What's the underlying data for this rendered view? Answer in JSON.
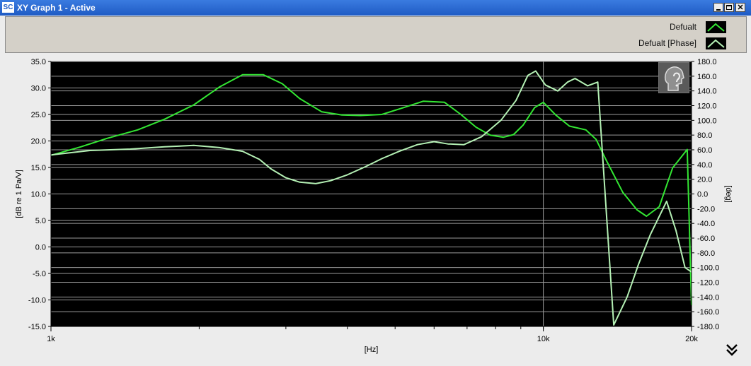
{
  "window": {
    "title": "XY Graph 1 - Active",
    "logo": "SC"
  },
  "legend": [
    {
      "label": "Defualt",
      "color": "#33e633"
    },
    {
      "label": "Defualt [Phase]",
      "color": "#b4f0b4"
    }
  ],
  "icons": {
    "help": "head-help-icon",
    "expand": "double-chevron-down-icon"
  },
  "chart_data": {
    "type": "line",
    "title": "",
    "xlabel": "[Hz]",
    "ylabel": "[dB re 1 Pa/V]",
    "y2label": "[deg]",
    "xscale": "log",
    "xlim": [
      1000,
      20000
    ],
    "ylim": [
      -15,
      35
    ],
    "y2lim": [
      -180,
      180
    ],
    "grid": true,
    "x_ticks": [
      "1k",
      "10k",
      "20k"
    ],
    "y_ticks": [
      "35.0",
      "30.0",
      "25.0",
      "20.0",
      "15.0",
      "10.0",
      "5.0",
      "0.0",
      "-5.0",
      "-10.0",
      "-15.0"
    ],
    "y2_ticks": [
      "180.0",
      "160.0",
      "140.0",
      "120.0",
      "100.0",
      "80.0",
      "60.0",
      "40.0",
      "20.0",
      "0.0",
      "-20.0",
      "-40.0",
      "-60.0",
      "-80.0",
      "-100.0",
      "-120.0",
      "-140.0",
      "-160.0",
      "-180.0"
    ],
    "background": "#000000",
    "series": [
      {
        "name": "Defualt",
        "axis": "left",
        "color": "#33e633",
        "x": [
          1000,
          1150,
          1300,
          1500,
          1700,
          1950,
          2200,
          2450,
          2700,
          2950,
          3200,
          3550,
          3900,
          4250,
          4700,
          5200,
          5700,
          6300,
          6800,
          7300,
          7800,
          8300,
          8700,
          9100,
          9600,
          10000,
          10600,
          11300,
          12200,
          12800,
          13400,
          14500,
          15500,
          16200,
          17200,
          18300,
          19600,
          20000
        ],
        "y": [
          17.3,
          18.9,
          20.5,
          22.1,
          24.1,
          26.8,
          30.2,
          32.5,
          32.5,
          30.8,
          28.0,
          25.5,
          24.9,
          24.8,
          25.0,
          26.3,
          27.5,
          27.3,
          25.0,
          22.6,
          21.1,
          20.7,
          21.2,
          23.0,
          26.3,
          27.3,
          24.9,
          22.8,
          22.1,
          20.3,
          16.5,
          10.3,
          7.0,
          5.8,
          7.6,
          14.9,
          18.4,
          -11.0
        ]
      },
      {
        "name": "Defualt [Phase]",
        "axis": "right",
        "color": "#b4f0b4",
        "x": [
          1000,
          1200,
          1450,
          1700,
          1950,
          2200,
          2450,
          2650,
          2800,
          3000,
          3200,
          3450,
          3700,
          4000,
          4350,
          4700,
          5100,
          5550,
          6000,
          6400,
          6900,
          7500,
          8200,
          8800,
          9300,
          9650,
          10100,
          10700,
          11200,
          11600,
          12300,
          12900,
          13900,
          14800,
          15600,
          16500,
          17800,
          18600,
          19400,
          20000
        ],
        "y": [
          53,
          59,
          61,
          64,
          66,
          63,
          58,
          47,
          34,
          22,
          16,
          14,
          18,
          26,
          37,
          48,
          58,
          67,
          71,
          68,
          67,
          78,
          100,
          127,
          161,
          167,
          148,
          140,
          152,
          157,
          147,
          152,
          -178,
          -140,
          -96,
          -55,
          -10,
          -50,
          -100,
          -106
        ]
      }
    ]
  }
}
